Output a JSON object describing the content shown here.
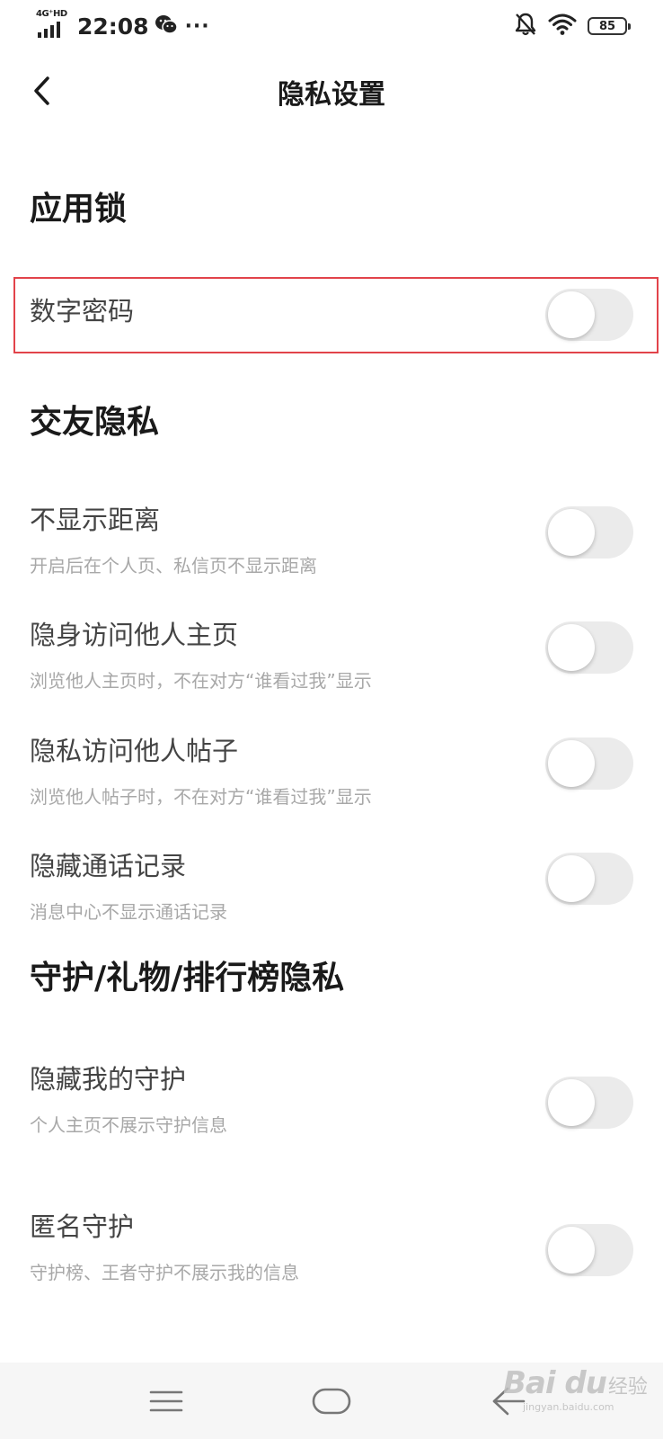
{
  "status_bar": {
    "network": "4G⁺HD",
    "time": "22:08",
    "more": "···",
    "battery": "85"
  },
  "header": {
    "title": "隐私设置",
    "back_icon": "chevron-left-icon"
  },
  "sections": {
    "app_lock": {
      "title": "应用锁",
      "items": [
        {
          "title": "数字密码",
          "enabled": false
        }
      ]
    },
    "social": {
      "title": "交友隐私",
      "items": [
        {
          "title": "不显示距离",
          "subtitle": "开启后在个人页、私信页不显示距离",
          "enabled": false
        },
        {
          "title": "隐身访问他人主页",
          "subtitle": "浏览他人主页时，不在对方“谁看过我”显示",
          "enabled": false
        },
        {
          "title": "隐私访问他人帖子",
          "subtitle": "浏览他人帖子时，不在对方“谁看过我”显示",
          "enabled": false
        },
        {
          "title": "隐藏通话记录",
          "subtitle": "消息中心不显示通话记录",
          "enabled": false
        }
      ]
    },
    "guard": {
      "title": "守护/礼物/排行榜隐私",
      "items": [
        {
          "title": "隐藏我的守护",
          "subtitle": "个人主页不展示守护信息",
          "enabled": false
        },
        {
          "title": "匿名守护",
          "subtitle": "守护榜、王者守护不展示我的信息",
          "enabled": false
        }
      ]
    }
  },
  "watermark": {
    "brand": "Bai du",
    "cn": "经验",
    "url": "jingyan.baidu.com"
  },
  "colors": {
    "highlight_border": "#e2434a",
    "toggle_off": "#ebebeb",
    "subtitle": "#a8a8a8",
    "nav_bg": "#f6f6f6"
  }
}
